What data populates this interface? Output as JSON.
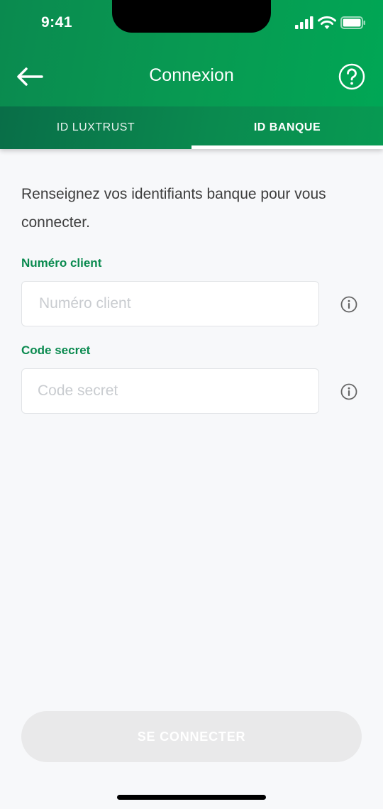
{
  "status_bar": {
    "time": "9:41"
  },
  "nav": {
    "title": "Connexion"
  },
  "tabs": [
    {
      "label": "ID LUXTRUST",
      "active": false
    },
    {
      "label": "ID BANQUE",
      "active": true
    }
  ],
  "intro_text": "Renseignez vos identifiants banque pour vous connecter.",
  "fields": {
    "client_number": {
      "label": "Numéro client",
      "placeholder": "Numéro client",
      "value": ""
    },
    "secret_code": {
      "label": "Code secret",
      "placeholder": "Code secret",
      "value": ""
    }
  },
  "connect_button": {
    "label": "SE CONNECTER"
  },
  "icons": {
    "back": "arrow-left-icon",
    "help": "help-circle-icon",
    "info": "info-circle-icon"
  },
  "colors": {
    "brand_green": "#0a8a4f",
    "disabled_button": "#e9e9ea",
    "background": "#f7f8fa"
  }
}
